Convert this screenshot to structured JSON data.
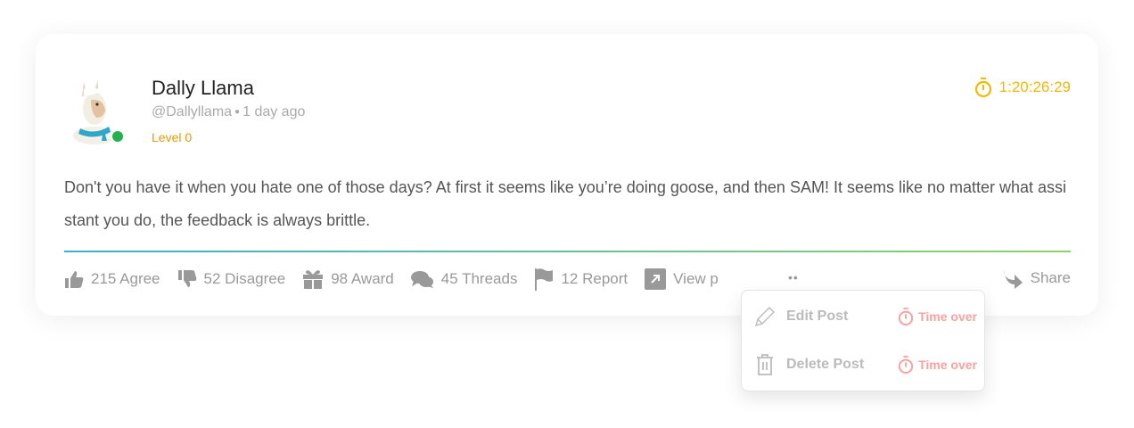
{
  "post": {
    "author_name": "Dally Llama",
    "handle": "@Dallyllama",
    "time_ago": "1 day ago",
    "level": "Level 0",
    "timer": "1:20:26:29",
    "body": "Don't you have it when you hate one of those days? At first it seems like you’re doing goose, and then SAM! It seems like no matter what assistant you do, the feedback is always brittle."
  },
  "actions": {
    "agree": "215 Agree",
    "disagree": "52 Disagree",
    "award": "98 Award",
    "threads": "45 Threads",
    "report": "12 Report",
    "view": "View p",
    "more": "••",
    "share": "Share"
  },
  "menu": {
    "edit": "Edit Post",
    "delete": "Delete Post",
    "edit_status": "Time over",
    "delete_status": "Time over"
  },
  "colors": {
    "accent": "#f5b800",
    "online": "#22b14c",
    "level": "#e69a00",
    "time_over": "#f7a1a1"
  }
}
